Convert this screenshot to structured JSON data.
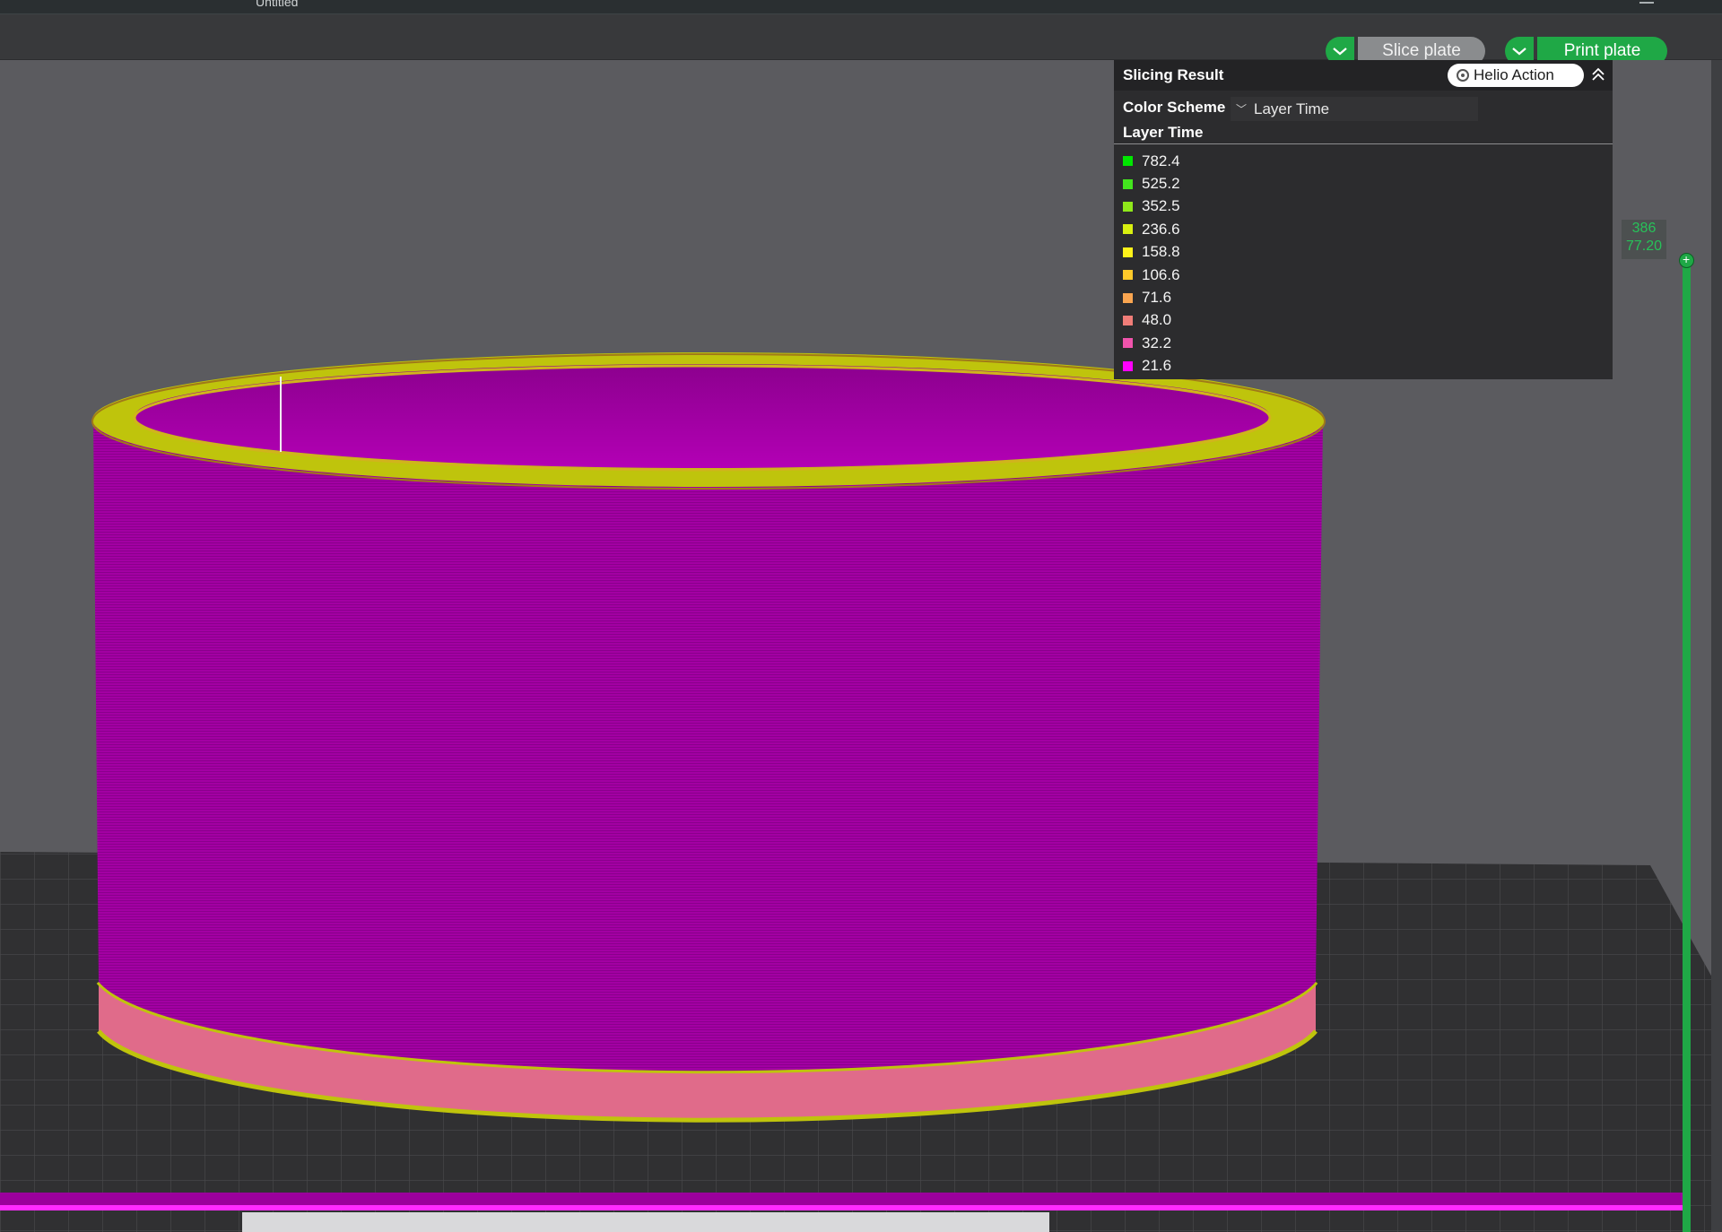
{
  "window": {
    "title": "Untitled"
  },
  "toolbar": {
    "slice_label": "Slice plate",
    "print_label": "Print plate"
  },
  "slicing_result": {
    "title": "Slicing Result",
    "helio_label": "Helio Action",
    "color_scheme_label": "Color Scheme",
    "color_scheme_value": "Layer Time",
    "legend_title": "Layer Time",
    "legend": [
      {
        "value": "782.4",
        "color": "#00e600"
      },
      {
        "value": "525.2",
        "color": "#43e51e"
      },
      {
        "value": "352.5",
        "color": "#8fe81a"
      },
      {
        "value": "236.6",
        "color": "#d8ef10"
      },
      {
        "value": "158.8",
        "color": "#fff21a"
      },
      {
        "value": "106.6",
        "color": "#ffca2a"
      },
      {
        "value": "71.6",
        "color": "#f9a550"
      },
      {
        "value": "48.0",
        "color": "#f07d78"
      },
      {
        "value": "32.2",
        "color": "#f054ac"
      },
      {
        "value": "21.6",
        "color": "#ff00ff"
      }
    ]
  },
  "layer_slider": {
    "layer": "386",
    "height": "77.20",
    "accent": "#1fa846"
  },
  "model": {
    "body_color": "#a300a3",
    "rim_color": "#bfc40c",
    "base_color": "#e06b8a"
  }
}
